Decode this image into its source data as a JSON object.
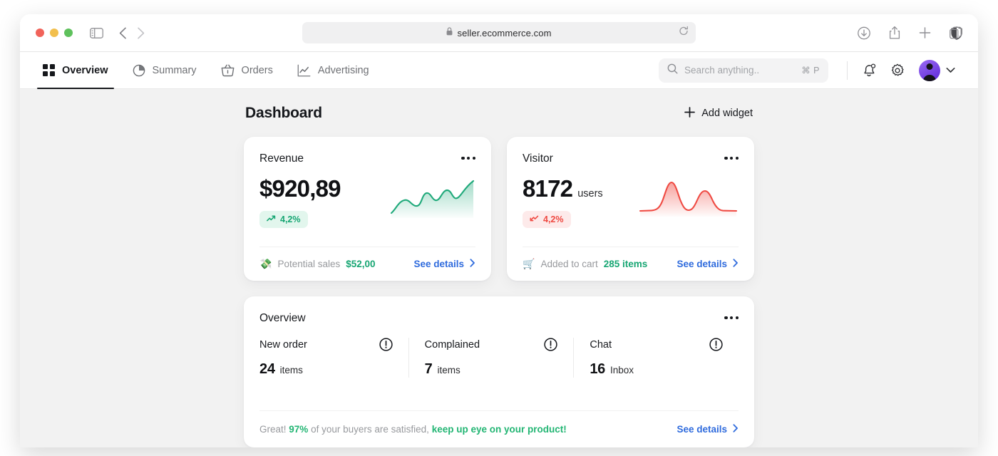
{
  "browser": {
    "url": "seller.ecommerce.com",
    "lock_icon": "lock-icon",
    "reload_icon": "reload-icon",
    "sidebar_icon": "sidebar-toggle-icon",
    "back_icon": "back-arrow-icon",
    "forward_icon": "forward-arrow-icon",
    "shield_icon": "privacy-shield-icon",
    "download_icon": "download-icon",
    "share_icon": "share-icon",
    "newtab_icon": "plus-icon",
    "tabs_icon": "tab-overview-icon"
  },
  "nav": {
    "tabs": [
      {
        "label": "Overview",
        "icon": "grid-icon",
        "active": true
      },
      {
        "label": "Summary",
        "icon": "pie-chart-icon",
        "active": false
      },
      {
        "label": "Orders",
        "icon": "basket-icon",
        "active": false
      },
      {
        "label": "Advertising",
        "icon": "line-chart-icon",
        "active": false
      }
    ],
    "search": {
      "placeholder": "Search anything..",
      "value": "",
      "shortcut": "⌘ P",
      "icon": "search-icon"
    },
    "notifications_icon": "bell-icon",
    "settings_icon": "gear-icon",
    "avatar": "user-avatar",
    "account_chevron": "chevron-down-icon"
  },
  "page": {
    "title": "Dashboard",
    "add_widget": {
      "label": "Add widget",
      "icon": "plus-icon"
    }
  },
  "revenue_card": {
    "title": "Revenue",
    "value": "$920,89",
    "badge": "4,2%",
    "badge_icon": "trending-up-icon",
    "foot_emoji": "💸",
    "foot_label": "Potential sales",
    "foot_value": "$52,00",
    "link": "See details",
    "menu_icon": "more-options-icon"
  },
  "visitor_card": {
    "title": "Visitor",
    "value": "8172",
    "unit": "users",
    "badge": "4,2%",
    "badge_icon": "trending-down-icon",
    "foot_emoji": "🛒",
    "foot_label": "Added to cart",
    "foot_value": "285 items",
    "link": "See details",
    "menu_icon": "more-options-icon"
  },
  "overview_card": {
    "title": "Overview",
    "menu_icon": "more-options-icon",
    "columns": [
      {
        "label": "New order",
        "value": "24",
        "unit": "items",
        "icon": "alert-circle-icon"
      },
      {
        "label": "Complained",
        "value": "7",
        "unit": "items",
        "icon": "alert-circle-icon"
      },
      {
        "label": "Chat",
        "value": "16",
        "unit": "Inbox",
        "icon": "alert-circle-icon"
      }
    ],
    "message_prefix": "Great!",
    "message_percent": "97%",
    "message_middle": "of your buyers are satisfied,",
    "message_accent": "keep up eye on your product!",
    "link": "See details"
  },
  "colors": {
    "green": "#17a673",
    "green_accent": "#22b573",
    "red": "#ef4a42",
    "link_blue": "#2f6bdd",
    "page_bg": "#f2f2f2",
    "text": "#16181c",
    "muted": "#97999d"
  },
  "chart_data": [
    {
      "type": "area",
      "name": "revenue-sparkline",
      "title": "Revenue",
      "color": "#1fa97a",
      "x": [
        0,
        1,
        2,
        3,
        4,
        5,
        6,
        7,
        8,
        9,
        10,
        11,
        12
      ],
      "values": [
        12,
        26,
        40,
        44,
        36,
        30,
        52,
        58,
        46,
        50,
        64,
        52,
        74
      ],
      "ylim": [
        0,
        80
      ],
      "grid": false,
      "legend": "none"
    },
    {
      "type": "area",
      "name": "visitor-sparkline",
      "title": "Visitor",
      "color": "#ef4a42",
      "x": [
        0,
        1,
        2,
        3,
        4,
        5,
        6,
        7,
        8,
        9,
        10,
        11,
        12
      ],
      "values": [
        4,
        5,
        8,
        26,
        62,
        30,
        12,
        22,
        44,
        30,
        12,
        6,
        5
      ],
      "ylim": [
        0,
        70
      ],
      "grid": false,
      "legend": "none"
    }
  ]
}
